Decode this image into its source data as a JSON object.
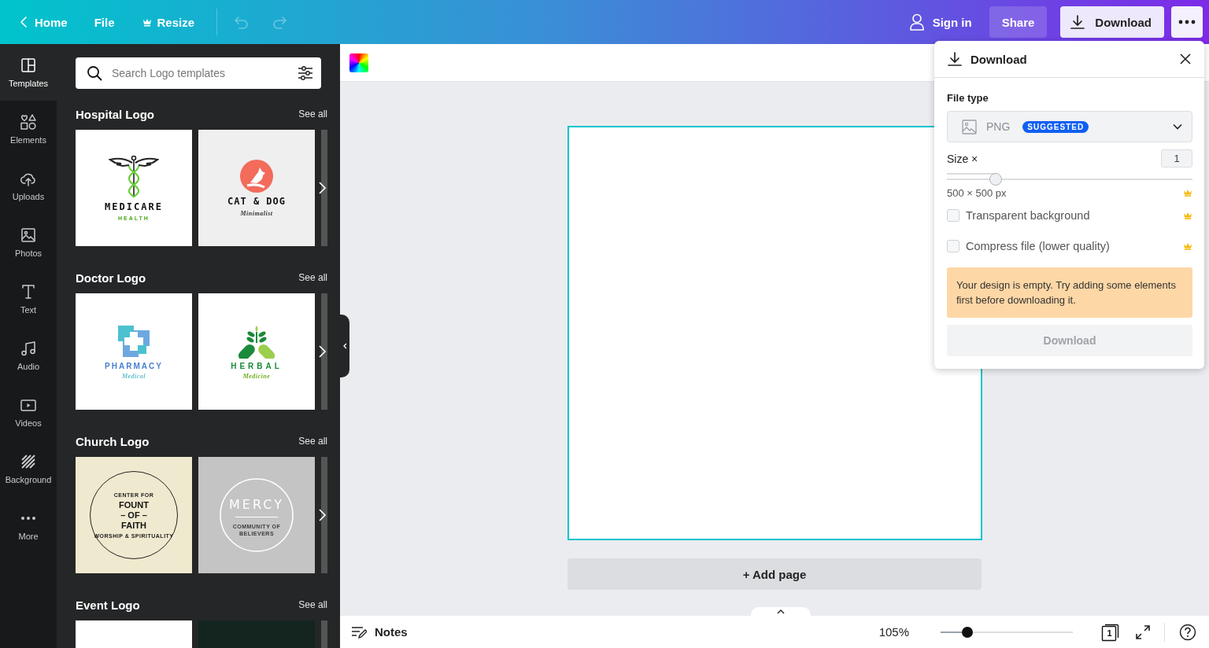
{
  "topbar": {
    "nav": [
      {
        "kind": "back",
        "label": "Home"
      },
      {
        "kind": "plain",
        "label": "File"
      },
      {
        "kind": "crown",
        "label": "Resize"
      }
    ],
    "undo": {
      "disabled": true
    },
    "redo": {
      "disabled": true
    },
    "sign_in": "Sign in",
    "share": "Share",
    "download": {
      "label": "Download",
      "selected": true
    }
  },
  "sidebar": {
    "items": [
      {
        "kind": "templates",
        "label": "Templates",
        "selected": true
      },
      {
        "kind": "elements",
        "label": "Elements",
        "selected": false
      },
      {
        "kind": "uploads",
        "label": "Uploads",
        "selected": false
      },
      {
        "kind": "photos",
        "label": "Photos",
        "selected": false
      },
      {
        "kind": "text",
        "label": "Text",
        "selected": false
      },
      {
        "kind": "audio",
        "label": "Audio",
        "selected": false
      },
      {
        "kind": "videos",
        "label": "Videos",
        "selected": false
      },
      {
        "kind": "background",
        "label": "Background",
        "selected": false
      },
      {
        "kind": "more",
        "label": "More",
        "selected": false
      }
    ]
  },
  "panel": {
    "search": {
      "placeholder": "Search Logo templates"
    },
    "sections": [
      {
        "title": "Hospital Logo",
        "see_all": "See all",
        "thumbnails": [
          {
            "kind": "caduceus",
            "title": "MEDICARE",
            "subtitle": "HEALTH"
          },
          {
            "kind": "pet",
            "title": "CAT & DOG",
            "subtitle": "Minimalist"
          }
        ]
      },
      {
        "title": "Doctor Logo",
        "see_all": "See all",
        "thumbnails": [
          {
            "kind": "pharmacy",
            "title": "PHARMACY",
            "subtitle": "Medical"
          },
          {
            "kind": "herbal",
            "title": "HERBAL",
            "subtitle": "Medicine"
          }
        ]
      },
      {
        "title": "Church Logo",
        "see_all": "See all",
        "thumbnails": [
          {
            "kind": "badge",
            "ring_top": "CENTER FOR",
            "ring_bottom": "WORSHIP & SPIRITUALITY",
            "title_lines": [
              "FOUNT",
              "– OF –",
              "FAITH"
            ]
          },
          {
            "kind": "mercy",
            "title": "MERCY",
            "subtitle": "COMMUNITY OF BELIEVERS"
          }
        ]
      },
      {
        "title": "Event Logo",
        "see_all": "See all",
        "thumbnails": [
          {
            "kind": "blank"
          },
          {
            "kind": "dark"
          }
        ]
      }
    ]
  },
  "canvas": {
    "add_page": "+ Add page"
  },
  "bottom_bar": {
    "notes": "Notes",
    "zoom": "105%",
    "zoom_slider": {
      "level": 0.2
    },
    "page_count": "1"
  },
  "download_panel": {
    "title": "Download",
    "file_type_label": "File type",
    "file_type": "PNG",
    "badge": "SUGGESTED",
    "size_label": "Size ×",
    "size_value": "1",
    "size_slider": {
      "level": 0.2
    },
    "dimensions": "500 × 500 px",
    "dimensions_premium": true,
    "options": [
      {
        "label": "Transparent background",
        "checked": false,
        "premium": true
      },
      {
        "label": "Compress file (lower quality)",
        "checked": false,
        "premium": true
      }
    ],
    "warning": "Your design is empty. Try adding some elements first before downloading it.",
    "button": {
      "label": "Download",
      "disabled": true
    }
  }
}
